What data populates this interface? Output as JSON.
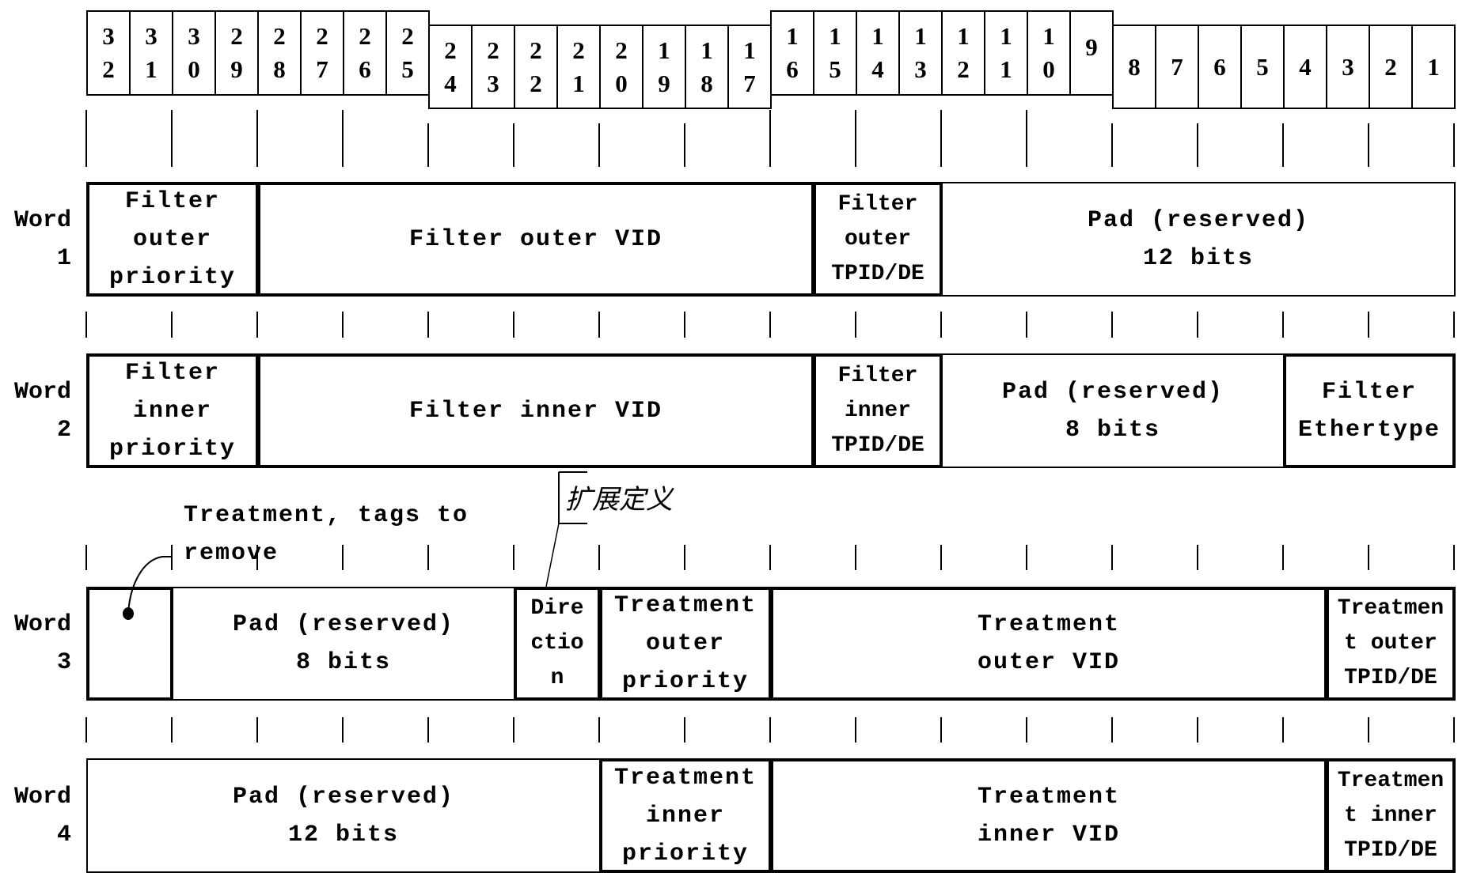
{
  "bit_header": {
    "groups": [
      {
        "level": "raised",
        "bits": [
          "32",
          "31",
          "30",
          "29",
          "28",
          "27",
          "26",
          "25"
        ]
      },
      {
        "level": "lowered",
        "bits": [
          "24",
          "23",
          "22",
          "21",
          "20",
          "19",
          "18",
          "17"
        ]
      },
      {
        "level": "raised",
        "bits": [
          "16",
          "15",
          "14",
          "13",
          "12",
          "11",
          "10",
          "9"
        ]
      },
      {
        "level": "lowered",
        "bits": [
          "8",
          "7",
          "6",
          "5",
          "4",
          "3",
          "2",
          "1"
        ]
      }
    ]
  },
  "words": [
    {
      "label": "Word\n1",
      "fields": [
        {
          "name": "filter-outer-priority",
          "text": "Filter\nouter\npriority",
          "bits": 4,
          "emphasis": "thick"
        },
        {
          "name": "filter-outer-vid",
          "text": "Filter outer VID",
          "bits": 13,
          "emphasis": "thick"
        },
        {
          "name": "filter-outer-tpid-de",
          "text": "Filter\nouter\nTPID/DE",
          "bits": 3,
          "emphasis": "thick"
        },
        {
          "name": "pad-reserved-12",
          "text": "Pad (reserved)\n12 bits",
          "bits": 12,
          "emphasis": "thin"
        }
      ]
    },
    {
      "label": "Word\n2",
      "fields": [
        {
          "name": "filter-inner-priority",
          "text": "Filter\ninner\npriority",
          "bits": 4,
          "emphasis": "thick"
        },
        {
          "name": "filter-inner-vid",
          "text": "Filter inner VID",
          "bits": 13,
          "emphasis": "thick"
        },
        {
          "name": "filter-inner-tpid-de",
          "text": "Filter\ninner\nTPID/DE",
          "bits": 3,
          "emphasis": "thick"
        },
        {
          "name": "pad-reserved-8",
          "text": "Pad (reserved)\n8 bits",
          "bits": 8,
          "emphasis": "thin"
        },
        {
          "name": "filter-ethertype",
          "text": "Filter\nEthertype",
          "bits": 4,
          "emphasis": "thick"
        }
      ]
    },
    {
      "label": "Word\n3",
      "fields": [
        {
          "name": "treatment-tags-to-remove",
          "text": "",
          "bits": 2,
          "emphasis": "thick"
        },
        {
          "name": "pad-reserved-8",
          "text": "Pad (reserved)\n8 bits",
          "bits": 8,
          "emphasis": "thin"
        },
        {
          "name": "direction",
          "text": "Dire\nctio\nn",
          "bits": 2,
          "emphasis": "thick"
        },
        {
          "name": "treatment-outer-priority",
          "text": "Treatment\nouter\npriority",
          "bits": 4,
          "emphasis": "thick"
        },
        {
          "name": "treatment-outer-vid",
          "text": "Treatment\nouter VID",
          "bits": 13,
          "emphasis": "thick"
        },
        {
          "name": "treatment-outer-tpid-de",
          "text": "Treatmen\nt outer\nTPID/DE",
          "bits": 3,
          "emphasis": "thick"
        }
      ]
    },
    {
      "label": "Word\n4",
      "fields": [
        {
          "name": "pad-reserved-12",
          "text": "Pad (reserved)\n12 bits",
          "bits": 12,
          "emphasis": "thin"
        },
        {
          "name": "treatment-inner-priority",
          "text": "Treatment\ninner\npriority",
          "bits": 4,
          "emphasis": "thick"
        },
        {
          "name": "treatment-inner-vid",
          "text": "Treatment\ninner VID",
          "bits": 13,
          "emphasis": "thick"
        },
        {
          "name": "treatment-inner-tpid-de",
          "text": "Treatmen\nt inner\nTPID/DE",
          "bits": 3,
          "emphasis": "thick"
        }
      ]
    }
  ],
  "annotations": {
    "tags_to_remove": "Treatment, tags to\nremove",
    "extension": "扩展定义"
  }
}
